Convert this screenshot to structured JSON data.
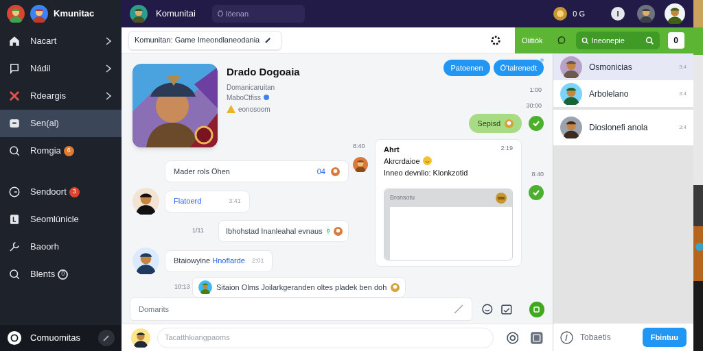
{
  "sidebar": {
    "brand": "Kmunitac",
    "items": [
      {
        "label": "Nacart",
        "chevron": true,
        "selected": false
      },
      {
        "label": "Nádil",
        "chevron": true,
        "selected": false
      },
      {
        "label": "Rdeargis",
        "chevron": true,
        "selected": false
      },
      {
        "label": "Sen(al)",
        "chevron": false,
        "selected": true
      },
      {
        "label": "Romgia",
        "chevron": false,
        "selected": false,
        "badge": {
          "text": "6",
          "color": "#e07a2e",
          "outline": false
        }
      }
    ],
    "items_secondary": [
      {
        "label": "Sendoort",
        "chevron": false,
        "selected": false,
        "badge": {
          "text": "3",
          "color": "#d9452f",
          "outline": false
        }
      },
      {
        "label": "Seomlúnicle",
        "chevron": false,
        "selected": false
      },
      {
        "label": "Baoorh",
        "chevron": false,
        "selected": false
      },
      {
        "label": "Blents",
        "chevron": false,
        "selected": false,
        "badge": {
          "text": "0",
          "color": "#d1d5db",
          "outline": true
        }
      }
    ],
    "footer": "Comuomitas"
  },
  "topbar": {
    "title": "Komunitai",
    "search": "Ö Iöenan",
    "coins": "0 G",
    "profile_initial": "I"
  },
  "toolbar": {
    "title": "Komunitan: Game Imeondlaneodania",
    "green_label": "Oiitiök",
    "search": "Ineonepie",
    "button": "0"
  },
  "chat": {
    "game": {
      "title": "Drado Dogoaia",
      "subtitle": "Domanicaruitan",
      "meta": "MaboCtfiss",
      "rating": "eonosoom"
    },
    "actions": [
      {
        "label": "Patoenen",
        "notify": false
      },
      {
        "label": "Ö'talrenedt",
        "notify": true
      }
    ],
    "times_top": [
      "1:00",
      "30:00"
    ],
    "sent": "Sepisd",
    "card": {
      "author": "Ahrt",
      "time": "2:19",
      "line1": "Akrcrdaioe",
      "line2": "Inneo devnlio: Klonkzotid",
      "attachment": "Bronsotu",
      "left_time": "8:40",
      "right_time": "8:40"
    },
    "messages": [
      {
        "kind": "plain",
        "text": "Mader rols Öhen",
        "count": "04"
      },
      {
        "kind": "avatar",
        "text": "Flatoerd",
        "highlight": true,
        "time": "3:41"
      },
      {
        "kind": "timed",
        "time": "1/11",
        "text": "Ibhohstad Inanleahal evnaus",
        "count": "0"
      },
      {
        "kind": "avatar",
        "text": "Btaiowyine",
        "link": "Hnoflarde",
        "highlight": false,
        "time": "2:01"
      },
      {
        "kind": "wide",
        "time": "10:13",
        "text": "Sitaion Olms Joilarkgeranden oltes pladek ben doh"
      }
    ],
    "composer": "Domarits",
    "bottom_field": "Tacatthkiangpaoms"
  },
  "conversations": [
    {
      "name": "Osmonicias",
      "time": "3:4",
      "selected": true
    },
    {
      "name": "Arbolelano",
      "time": "3:4",
      "selected": false
    },
    {
      "name": "Dioslonefi anola",
      "time": "3:4",
      "selected": false
    }
  ],
  "panel_footer": {
    "label": "Tobaetis",
    "button": "Fbintuu"
  }
}
